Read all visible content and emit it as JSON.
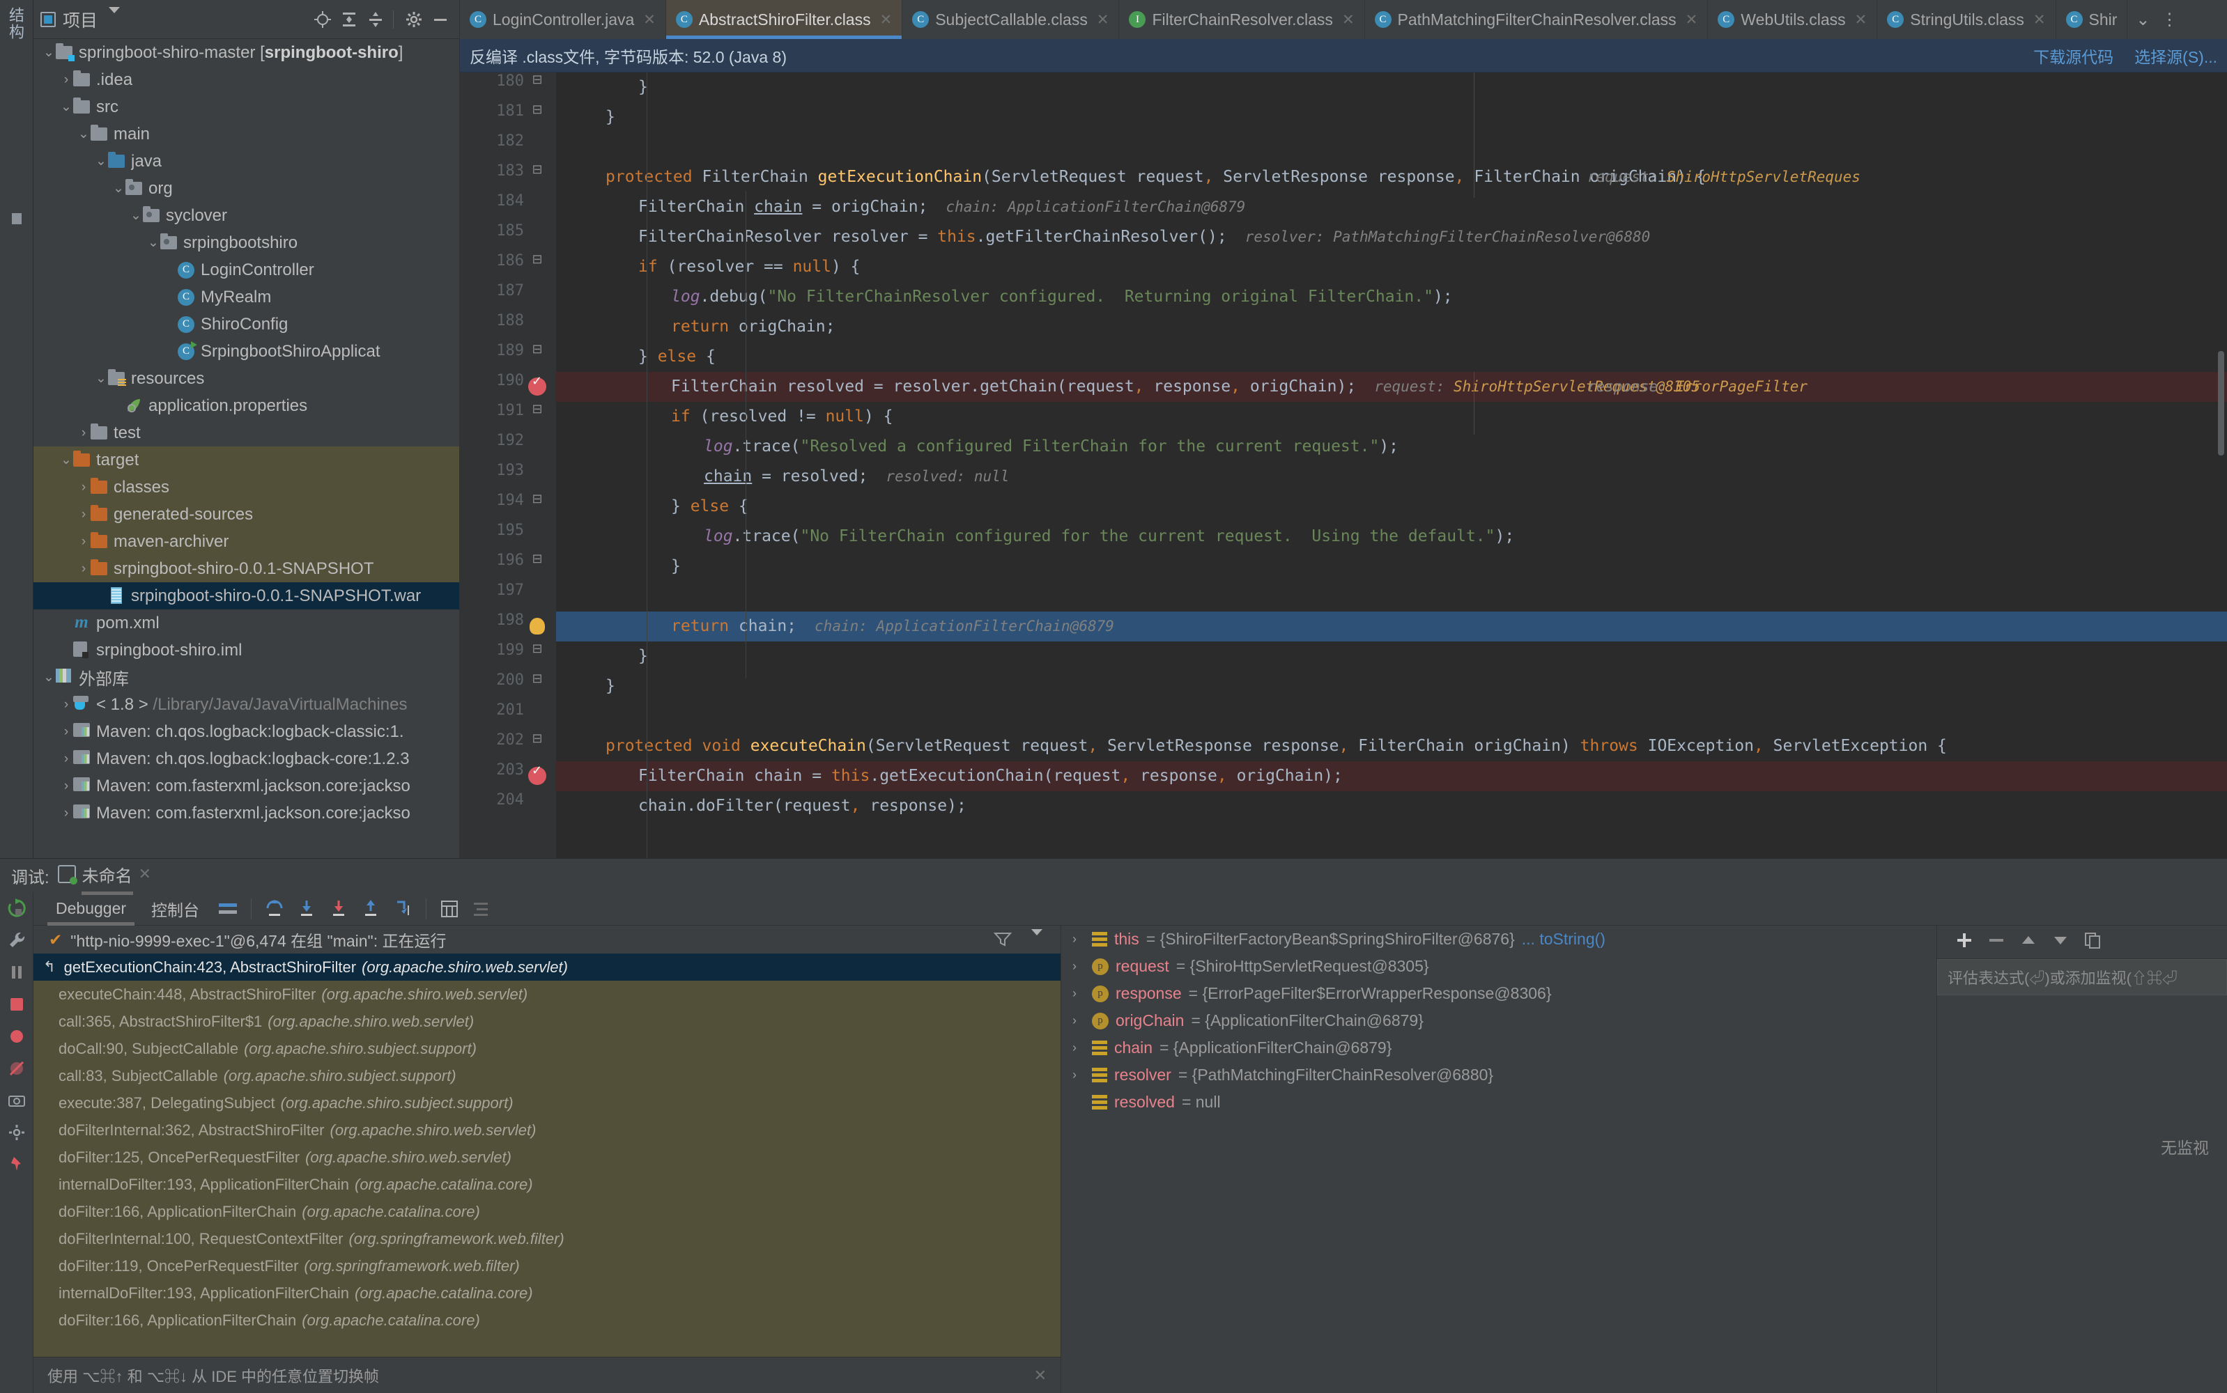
{
  "rail": {
    "vertical_label": "结构",
    "icons": [
      "bookmark-icon",
      "marker-icon"
    ]
  },
  "project_panel": {
    "title": "项目",
    "header_icons": [
      "locate-icon",
      "collapse-all-icon",
      "expand-all-icon",
      "settings-gear-icon",
      "minimize-icon"
    ],
    "tree": [
      {
        "depth": 0,
        "chev": "v",
        "icon": "module-folder",
        "label": "springboot-shiro-master [",
        "bold": "srpingboot-shiro",
        "suffix": "]"
      },
      {
        "depth": 1,
        "chev": ">",
        "icon": "folder",
        "label": ".idea"
      },
      {
        "depth": 1,
        "chev": "v",
        "icon": "folder",
        "label": "src"
      },
      {
        "depth": 2,
        "chev": "v",
        "icon": "folder",
        "label": "main"
      },
      {
        "depth": 3,
        "chev": "v",
        "icon": "folder-blue",
        "label": "java"
      },
      {
        "depth": 4,
        "chev": "v",
        "icon": "package",
        "label": "org"
      },
      {
        "depth": 5,
        "chev": "v",
        "icon": "package",
        "label": "syclover"
      },
      {
        "depth": 6,
        "chev": "v",
        "icon": "package",
        "label": "srpingbootshiro"
      },
      {
        "depth": 7,
        "chev": "",
        "icon": "class",
        "label": "LoginController"
      },
      {
        "depth": 7,
        "chev": "",
        "icon": "class",
        "label": "MyRealm"
      },
      {
        "depth": 7,
        "chev": "",
        "icon": "class",
        "label": "ShiroConfig"
      },
      {
        "depth": 7,
        "chev": "",
        "icon": "class-runnable",
        "label": "SrpingbootShiroApplicat"
      },
      {
        "depth": 3,
        "chev": "v",
        "icon": "folder-resources",
        "label": "resources"
      },
      {
        "depth": 4,
        "chev": "",
        "icon": "spring-leaf",
        "label": "application.properties"
      },
      {
        "depth": 2,
        "chev": ">",
        "icon": "folder",
        "label": "test"
      },
      {
        "depth": 1,
        "chev": "v",
        "icon": "folder-orange",
        "label": "target",
        "ctx": true
      },
      {
        "depth": 2,
        "chev": ">",
        "icon": "folder-orange",
        "label": "classes",
        "ctx": true
      },
      {
        "depth": 2,
        "chev": ">",
        "icon": "folder-orange",
        "label": "generated-sources",
        "ctx": true
      },
      {
        "depth": 2,
        "chev": ">",
        "icon": "folder-orange",
        "label": "maven-archiver",
        "ctx": true
      },
      {
        "depth": 2,
        "chev": ">",
        "icon": "folder-orange",
        "label": "srpingboot-shiro-0.0.1-SNAPSHOT",
        "ctx": true
      },
      {
        "depth": 3,
        "chev": "",
        "icon": "war-archive",
        "label": "srpingboot-shiro-0.0.1-SNAPSHOT.war",
        "sel": true
      },
      {
        "depth": 1,
        "chev": "",
        "icon": "maven-m",
        "label": "pom.xml"
      },
      {
        "depth": 1,
        "chev": "",
        "icon": "iml",
        "label": "srpingboot-shiro.iml"
      },
      {
        "depth": 0,
        "chev": "v",
        "icon": "libraries",
        "label": "外部库"
      },
      {
        "depth": 1,
        "chev": ">",
        "icon": "jdk",
        "label": "< 1.8 > ",
        "dim": "/Library/Java/JavaVirtualMachines"
      },
      {
        "depth": 1,
        "chev": ">",
        "icon": "maven-lib",
        "label": "Maven: ch.qos.logback:logback-classic:1."
      },
      {
        "depth": 1,
        "chev": ">",
        "icon": "maven-lib",
        "label": "Maven: ch.qos.logback:logback-core:1.2.3"
      },
      {
        "depth": 1,
        "chev": ">",
        "icon": "maven-lib",
        "label": "Maven: com.fasterxml.jackson.core:jackso"
      },
      {
        "depth": 1,
        "chev": ">",
        "icon": "maven-lib",
        "label": "Maven: com.fasterxml.jackson.core:jackso"
      }
    ]
  },
  "tabs": [
    {
      "label": "LoginController.java",
      "icon": "class",
      "active": false
    },
    {
      "label": "AbstractShiroFilter.class",
      "icon": "class",
      "active": true
    },
    {
      "label": "SubjectCallable.class",
      "icon": "class",
      "active": false
    },
    {
      "label": "FilterChainResolver.class",
      "icon": "interface",
      "active": false
    },
    {
      "label": "PathMatchingFilterChainResolver.class",
      "icon": "class",
      "active": false
    },
    {
      "label": "WebUtils.class",
      "icon": "class",
      "active": false
    },
    {
      "label": "StringUtils.class",
      "icon": "class",
      "active": false
    },
    {
      "label": "Shir",
      "icon": "class",
      "active": false
    }
  ],
  "tab_overflow_icons": [
    "chevron-down-icon",
    "more-vertical-icon"
  ],
  "notice": {
    "text": "反编译 .class文件, 字节码版本: 52.0 (Java 8)",
    "download_source": "下载源代码",
    "choose_source": "选择源(S)..."
  },
  "editor": {
    "lines": [
      {
        "num": "180",
        "fold": "minus",
        "indent": 2,
        "tokens": [
          {
            "t": "}",
            "c": "pun"
          }
        ]
      },
      {
        "num": "181",
        "fold": "minus",
        "indent": 1,
        "tokens": [
          {
            "t": "}",
            "c": "pun"
          }
        ]
      },
      {
        "num": "182",
        "fold": "",
        "indent": 0,
        "tokens": []
      },
      {
        "num": "183",
        "fold": "minus",
        "indent": 1,
        "tokens": [
          {
            "t": "protected ",
            "c": "kw"
          },
          {
            "t": "FilterChain ",
            "c": "typ"
          },
          {
            "t": "getExecutionChain",
            "c": "mth"
          },
          {
            "t": "(",
            "c": "pun"
          },
          {
            "t": "ServletRequest request",
            "c": "typ"
          },
          {
            "t": ", ",
            "c": "kw"
          },
          {
            "t": "ServletResponse response",
            "c": "typ"
          },
          {
            "t": ", ",
            "c": "kw"
          },
          {
            "t": "FilterChain origChain",
            "c": "typ"
          },
          {
            "t": ") {",
            "c": "pun"
          }
        ],
        "inlay_far": [
          {
            "t": "request: ",
            "c": "hint"
          },
          {
            "t": "ShiroHttpServletReques",
            "c": "hintv"
          }
        ]
      },
      {
        "num": "184",
        "fold": "",
        "indent": 2,
        "tokens": [
          {
            "t": "FilterChain ",
            "c": "typ"
          },
          {
            "t": "chain",
            "c": "typ ul"
          },
          {
            "t": " = origChain;",
            "c": "typ"
          }
        ],
        "inlay": [
          {
            "t": "chain: ",
            "c": "hint"
          },
          {
            "t": "ApplicationFilterChain@6879",
            "c": "hint"
          }
        ]
      },
      {
        "num": "185",
        "fold": "",
        "indent": 2,
        "tokens": [
          {
            "t": "FilterChainResolver resolver = ",
            "c": "typ"
          },
          {
            "t": "this",
            "c": "kw"
          },
          {
            "t": ".getFilterChainResolver();",
            "c": "typ"
          }
        ],
        "inlay": [
          {
            "t": "resolver: ",
            "c": "hint"
          },
          {
            "t": "PathMatchingFilterChainResolver@6880",
            "c": "hint"
          }
        ]
      },
      {
        "num": "186",
        "fold": "minus",
        "indent": 2,
        "tokens": [
          {
            "t": "if",
            "c": "kw"
          },
          {
            "t": " (resolver == ",
            "c": "typ"
          },
          {
            "t": "null",
            "c": "kw"
          },
          {
            "t": ") {",
            "c": "typ"
          }
        ]
      },
      {
        "num": "187",
        "fold": "",
        "indent": 3,
        "tokens": [
          {
            "t": "log",
            "c": "fld2"
          },
          {
            "t": ".debug(",
            "c": "typ"
          },
          {
            "t": "\"No FilterChainResolver configured.  Returning original FilterChain.\"",
            "c": "str"
          },
          {
            "t": ");",
            "c": "typ"
          }
        ]
      },
      {
        "num": "188",
        "fold": "",
        "indent": 3,
        "tokens": [
          {
            "t": "return",
            "c": "kw"
          },
          {
            "t": " origChain;",
            "c": "typ"
          }
        ]
      },
      {
        "num": "189",
        "fold": "minus",
        "indent": 2,
        "tokens": [
          {
            "t": "} ",
            "c": "typ"
          },
          {
            "t": "else",
            "c": "kw"
          },
          {
            "t": " {",
            "c": "typ"
          }
        ]
      },
      {
        "num": "190",
        "fold": "breakpoint",
        "indent": 3,
        "hl": "red",
        "tokens": [
          {
            "t": "FilterChain resolved = resolver.getChain(request",
            "c": "typ"
          },
          {
            "t": ", ",
            "c": "kw"
          },
          {
            "t": "response",
            "c": "typ"
          },
          {
            "t": ", ",
            "c": "kw"
          },
          {
            "t": "origChain);",
            "c": "typ"
          }
        ],
        "inlay": [
          {
            "t": "request: ",
            "c": "hint"
          },
          {
            "t": "ShiroHttpServletRequest@8305",
            "c": "hintv"
          }
        ],
        "inlay_far": [
          {
            "t": "response: ",
            "c": "hint"
          },
          {
            "t": "ErrorPageFilter",
            "c": "hintv"
          }
        ]
      },
      {
        "num": "191",
        "fold": "minus",
        "indent": 3,
        "tokens": [
          {
            "t": "if",
            "c": "kw"
          },
          {
            "t": " (resolved != ",
            "c": "typ"
          },
          {
            "t": "null",
            "c": "kw"
          },
          {
            "t": ") {",
            "c": "typ"
          }
        ]
      },
      {
        "num": "192",
        "fold": "",
        "indent": 4,
        "tokens": [
          {
            "t": "log",
            "c": "fld2"
          },
          {
            "t": ".trace(",
            "c": "typ"
          },
          {
            "t": "\"Resolved a configured FilterChain for the current request.\"",
            "c": "str"
          },
          {
            "t": ");",
            "c": "typ"
          }
        ]
      },
      {
        "num": "193",
        "fold": "",
        "indent": 4,
        "tokens": [
          {
            "t": "chain",
            "c": "typ ul"
          },
          {
            "t": " = resolved;",
            "c": "typ"
          }
        ],
        "inlay": [
          {
            "t": "resolved: ",
            "c": "hint"
          },
          {
            "t": "null",
            "c": "hint"
          }
        ]
      },
      {
        "num": "194",
        "fold": "minus",
        "indent": 3,
        "tokens": [
          {
            "t": "} ",
            "c": "typ"
          },
          {
            "t": "else",
            "c": "kw"
          },
          {
            "t": " {",
            "c": "typ"
          }
        ]
      },
      {
        "num": "195",
        "fold": "",
        "indent": 4,
        "tokens": [
          {
            "t": "log",
            "c": "fld2"
          },
          {
            "t": ".trace(",
            "c": "typ"
          },
          {
            "t": "\"No FilterChain configured for the current request.  Using the default.\"",
            "c": "str"
          },
          {
            "t": ");",
            "c": "typ"
          }
        ]
      },
      {
        "num": "196",
        "fold": "minus",
        "indent": 3,
        "tokens": [
          {
            "t": "}",
            "c": "typ"
          }
        ]
      },
      {
        "num": "197",
        "fold": "",
        "indent": 0,
        "tokens": []
      },
      {
        "num": "198",
        "fold": "bulb",
        "indent": 3,
        "hl": "blue",
        "tokens": [
          {
            "t": "return",
            "c": "kw"
          },
          {
            "t": " chain;",
            "c": "typ"
          }
        ],
        "inlay": [
          {
            "t": "chain: ",
            "c": "hint"
          },
          {
            "t": "ApplicationFilterChain@6879",
            "c": "hint"
          }
        ]
      },
      {
        "num": "199",
        "fold": "minus",
        "indent": 2,
        "tokens": [
          {
            "t": "}",
            "c": "typ"
          }
        ]
      },
      {
        "num": "200",
        "fold": "minus",
        "indent": 1,
        "tokens": [
          {
            "t": "}",
            "c": "typ"
          }
        ]
      },
      {
        "num": "201",
        "fold": "",
        "indent": 0,
        "tokens": []
      },
      {
        "num": "202",
        "fold": "minus",
        "indent": 1,
        "tokens": [
          {
            "t": "protected ",
            "c": "kw"
          },
          {
            "t": "void ",
            "c": "kw"
          },
          {
            "t": "executeChain",
            "c": "mth"
          },
          {
            "t": "(ServletRequest request",
            "c": "typ"
          },
          {
            "t": ", ",
            "c": "kw"
          },
          {
            "t": "ServletResponse response",
            "c": "typ"
          },
          {
            "t": ", ",
            "c": "kw"
          },
          {
            "t": "FilterChain origChain) ",
            "c": "typ"
          },
          {
            "t": "throws ",
            "c": "kw"
          },
          {
            "t": "IOException",
            "c": "typ"
          },
          {
            "t": ", ",
            "c": "kw"
          },
          {
            "t": "ServletException {",
            "c": "typ"
          }
        ]
      },
      {
        "num": "203",
        "fold": "breakpoint",
        "indent": 2,
        "hl": "red",
        "tokens": [
          {
            "t": "FilterChain chain = ",
            "c": "typ"
          },
          {
            "t": "this",
            "c": "kw"
          },
          {
            "t": ".getExecutionChain(request",
            "c": "typ"
          },
          {
            "t": ", ",
            "c": "kw"
          },
          {
            "t": "response",
            "c": "typ"
          },
          {
            "t": ", ",
            "c": "kw"
          },
          {
            "t": "origChain);",
            "c": "typ"
          }
        ]
      },
      {
        "num": "204",
        "fold": "",
        "indent": 2,
        "tokens": [
          {
            "t": "chain.doFilter(request",
            "c": "typ"
          },
          {
            "t": ", ",
            "c": "kw"
          },
          {
            "t": "response);",
            "c": "typ"
          }
        ]
      }
    ]
  },
  "debug": {
    "panel_label": "调试:",
    "session_name": "未命名",
    "toolbar": {
      "tabs": [
        {
          "label": "Debugger",
          "active": true
        },
        {
          "label": "控制台",
          "active": false
        }
      ],
      "icons": [
        "layout-icon",
        "step-over-icon",
        "step-into-icon",
        "force-step-into-icon",
        "step-out-icon",
        "run-to-cursor-icon",
        "evaluate-icon",
        "mute-breakpoints-icon"
      ]
    },
    "rail_icons": [
      "rerun-icon",
      "wrench-icon",
      "pause-icon",
      "stop-icon",
      "breakpoints-icon",
      "mute-icon",
      "camera-icon",
      "settings-icon",
      "pin-icon"
    ],
    "thread": "\"http-nio-9999-exec-1\"@6,474 在组 \"main\": 正在运行",
    "frames": [
      {
        "label": "getExecutionChain:423, AbstractShiroFilter",
        "pkg": "(org.apache.shiro.web.servlet)",
        "selected": true
      },
      {
        "label": "executeChain:448, AbstractShiroFilter",
        "pkg": "(org.apache.shiro.web.servlet)"
      },
      {
        "label": "call:365, AbstractShiroFilter$1",
        "pkg": "(org.apache.shiro.web.servlet)"
      },
      {
        "label": "doCall:90, SubjectCallable",
        "pkg": "(org.apache.shiro.subject.support)"
      },
      {
        "label": "call:83, SubjectCallable",
        "pkg": "(org.apache.shiro.subject.support)"
      },
      {
        "label": "execute:387, DelegatingSubject",
        "pkg": "(org.apache.shiro.subject.support)"
      },
      {
        "label": "doFilterInternal:362, AbstractShiroFilter",
        "pkg": "(org.apache.shiro.web.servlet)"
      },
      {
        "label": "doFilter:125, OncePerRequestFilter",
        "pkg": "(org.apache.shiro.web.servlet)"
      },
      {
        "label": "internalDoFilter:193, ApplicationFilterChain",
        "pkg": "(org.apache.catalina.core)"
      },
      {
        "label": "doFilter:166, ApplicationFilterChain",
        "pkg": "(org.apache.catalina.core)"
      },
      {
        "label": "doFilterInternal:100, RequestContextFilter",
        "pkg": "(org.springframework.web.filter)"
      },
      {
        "label": "doFilter:119, OncePerRequestFilter",
        "pkg": "(org.springframework.web.filter)"
      },
      {
        "label": "internalDoFilter:193, ApplicationFilterChain",
        "pkg": "(org.apache.catalina.core)"
      },
      {
        "label": "doFilter:166, ApplicationFilterChain",
        "pkg": "(org.apache.catalina.core)"
      }
    ],
    "hint_bar": "使用 ⌥⌘↑ 和 ⌥⌘↓ 从 IDE 中的任意位置切换帧",
    "variables": [
      {
        "chev": ">",
        "icon": "stack",
        "name": "this",
        "value": "= {ShiroFilterFactoryBean$SpringShiroFilter@6876}",
        "extra": "... toString()"
      },
      {
        "chev": ">",
        "icon": "param",
        "name": "request",
        "value": "= {ShiroHttpServletRequest@8305}"
      },
      {
        "chev": ">",
        "icon": "param",
        "name": "response",
        "value": "= {ErrorPageFilter$ErrorWrapperResponse@8306}"
      },
      {
        "chev": ">",
        "icon": "param",
        "name": "origChain",
        "value": "= {ApplicationFilterChain@6879}"
      },
      {
        "chev": ">",
        "icon": "stack",
        "name": "chain",
        "value": "= {ApplicationFilterChain@6879}"
      },
      {
        "chev": ">",
        "icon": "stack",
        "name": "resolver",
        "value": "= {PathMatchingFilterChainResolver@6880}"
      },
      {
        "chev": "",
        "icon": "stack",
        "name": "resolved",
        "value": "= null"
      }
    ],
    "watches": {
      "toolbar_icons": [
        "add-watch-icon",
        "remove-watch-icon",
        "move-up-icon",
        "move-down-icon",
        "copy-icon"
      ],
      "placeholder": "评估表达式(⏎)或添加监视(⇧⌘⏎",
      "empty_text": "无监视"
    }
  }
}
